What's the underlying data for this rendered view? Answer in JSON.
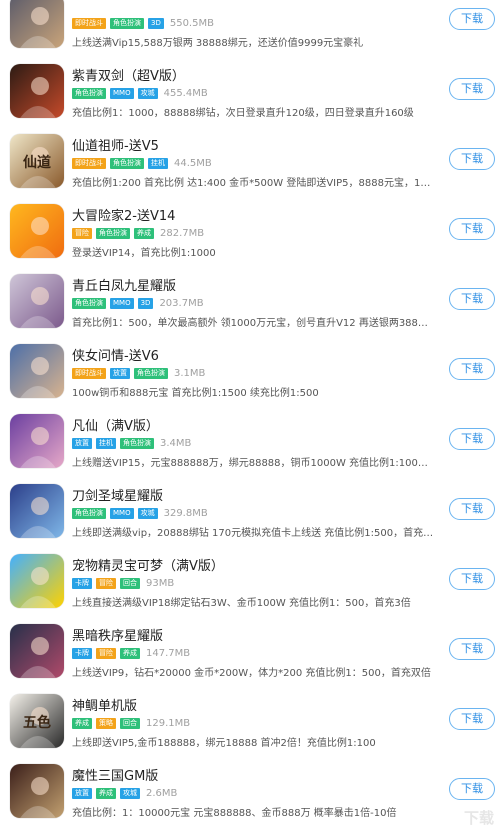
{
  "button_label": "下载",
  "colors": {
    "accent": "#2f8fe4",
    "tag_orange": "#f3a31a",
    "tag_green": "#2ec07a",
    "tag_blue": "#27a2e6",
    "tag_red": "#e8402f",
    "tag_purple": "#8766d6"
  },
  "games": [
    {
      "name": "",
      "size": "550.5MB",
      "desc": "上线送满Vip15,588万银两 38888绑元，还送价值9999元宝豪礼",
      "tags": [
        "即时战斗",
        "角色扮演",
        "3D"
      ]
    },
    {
      "name": "紫青双剑（超V版）",
      "size": "455.4MB",
      "desc": "充值比例1：1000，88888绑钻，次日登录直升120级，四日登录直升160级",
      "tags": [
        "角色扮演",
        "MMO",
        "攻城"
      ]
    },
    {
      "name": "仙道祖师-送V5",
      "size": "44.5MB",
      "desc": "充值比例1:200 首充比例 达1:400 金币*500W 登陆即送VIP5，8888元宝，188888…",
      "tags": [
        "即时战斗",
        "角色扮演",
        "挂机"
      ],
      "icon_text": "仙道祖师"
    },
    {
      "name": "大冒险家2-送V14",
      "size": "282.7MB",
      "desc": "登录送VIP14，首充比例1:1000",
      "tags": [
        "冒险",
        "角色扮演",
        "养成"
      ]
    },
    {
      "name": "青丘白凤九星耀版",
      "size": "203.7MB",
      "desc": "首充比例1：500，单次最高额外 领1000万元宝，创号直升V12 再送银两38888…",
      "tags": [
        "角色扮演",
        "MMO",
        "3D"
      ]
    },
    {
      "name": "侠女问情-送V6",
      "size": "3.1MB",
      "desc": "100w铜币和888元宝 首充比例1:1500 续充比例1:500",
      "tags": [
        "即时战斗",
        "放置",
        "角色扮演"
      ]
    },
    {
      "name": "凡仙（满V版）",
      "size": "3.4MB",
      "desc": "上线赠送VIP15，元宝888888万，绑元88888，铜币1000W 充值比例1:1000…",
      "tags": [
        "放置",
        "挂机",
        "角色扮演"
      ]
    },
    {
      "name": "刀剑圣域星耀版",
      "size": "329.8MB",
      "desc": "上线即送满级vip，20888绑钻 170元模拟充值卡上线送 充值比例1:500，首充…",
      "tags": [
        "角色扮演",
        "MMO",
        "攻城"
      ]
    },
    {
      "name": "宠物精灵宝可梦（满V版）",
      "size": "93MB",
      "desc": "上线直接送满级VIP18绑定钻石3W、金币100W 充值比例1：500，首充3倍",
      "tags": [
        "卡牌",
        "冒险",
        "回合"
      ]
    },
    {
      "name": "黑暗秩序星耀版",
      "size": "147.7MB",
      "desc": "上线送VIP9，钻石*20000 金币*200W，体力*200 充值比例1：500，首充双倍",
      "tags": [
        "卡牌",
        "冒险",
        "养成"
      ]
    },
    {
      "name": "神鲷单机版",
      "size": "129.1MB",
      "desc": "上线即送VIP5,金币188888，绑元18888 首冲2倍！充值比例1:100",
      "tags": [
        "养成",
        "策略",
        "回合"
      ],
      "icon_text": "五色"
    },
    {
      "name": "魔性三国GM版",
      "size": "2.6MB",
      "desc": "充值比例：1：10000元宝 元宝888888、金币888万 概率暴击1倍-10倍",
      "tags": [
        "放置",
        "养成",
        "攻城"
      ]
    }
  ],
  "watermark": "下载"
}
